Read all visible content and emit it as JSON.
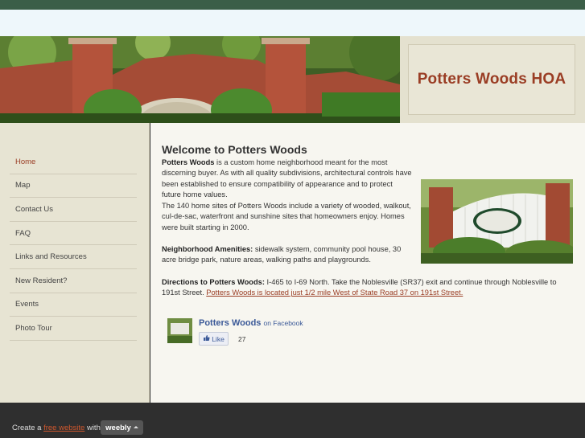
{
  "site": {
    "title": "Potters Woods HOA"
  },
  "nav": {
    "items": [
      {
        "label": "Home"
      },
      {
        "label": "Map"
      },
      {
        "label": "Contact Us"
      },
      {
        "label": "FAQ"
      },
      {
        "label": "Links and Resources"
      },
      {
        "label": "New Resident?"
      },
      {
        "label": "Events"
      },
      {
        "label": "Photo Tour"
      }
    ]
  },
  "main": {
    "heading": "Welcome to Potters Woods",
    "p1_bold": "Potters Woods",
    "p1_text": " is a custom home neighborhood meant for the most discerning buyer. As with all quality subdivisions, architectural controls have been established to ensure compatibility of appearance and to protect future home values.",
    "p2_text": "The 140 home sites of Potters Woods include a variety of wooded, walkout, cul-de-sac, waterfront and sunshine sites that homeowners enjoy. Homes were built starting in 2000.",
    "p3_bold": "Neighborhood Amenities:",
    "p3_text": " sidewalk system, community pool house, 30 acre bridge park, nature areas, walking paths and playgrounds.",
    "p4_bold": "Directions to Potters Woods:",
    "p4_text": " I-465 to I-69 North. Take the Noblesville (SR37) exit and continue through Noblesville to 191st Street. ",
    "p4_link": "Potters Woods is located just 1/2 mile West of State Road 37 on 191st Street."
  },
  "facebook": {
    "name": "Potters Woods",
    "suffix": "on Facebook",
    "like_label": "Like",
    "like_count": "27",
    "brand_color": "#3b5998"
  },
  "footer": {
    "prefix": "Create a ",
    "link": "free website",
    "suffix": " with",
    "badge": "weebly"
  }
}
